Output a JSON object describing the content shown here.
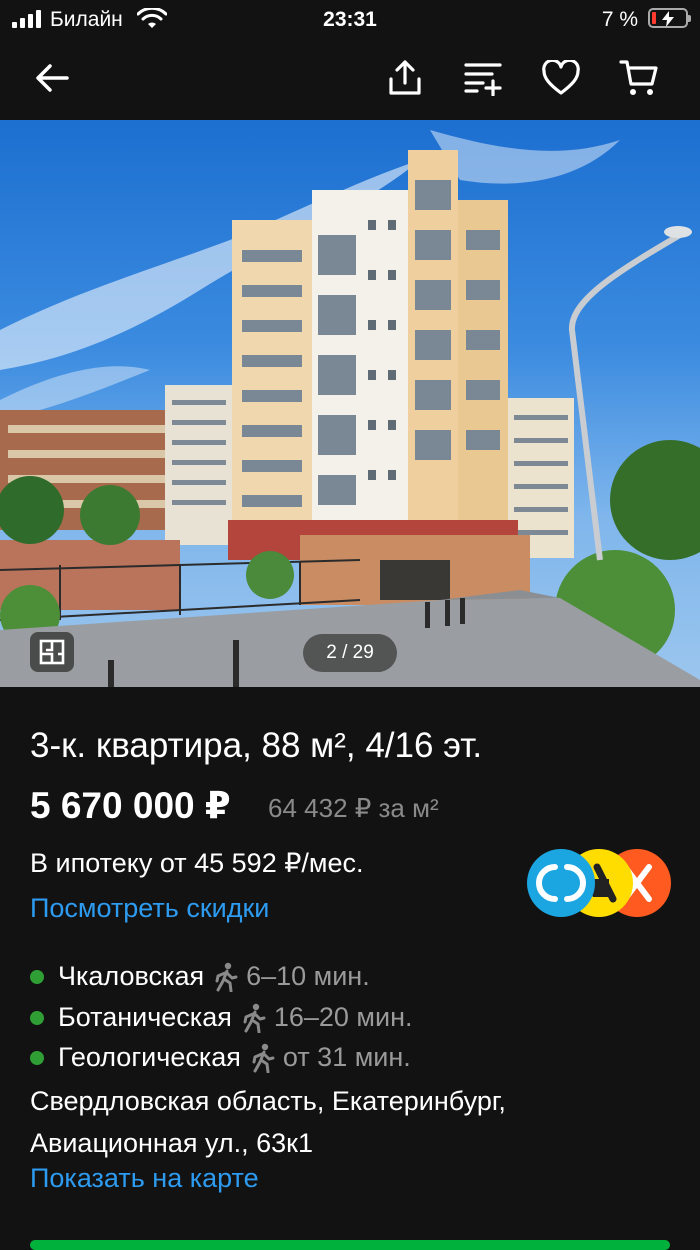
{
  "status_bar": {
    "carrier": "Билайн",
    "time": "23:31",
    "battery": "7 %"
  },
  "nav": {
    "icons": [
      "back-arrow-icon",
      "share-icon",
      "compare-icon",
      "heart-icon",
      "cart-icon"
    ]
  },
  "gallery": {
    "counter": "2 / 29"
  },
  "listing": {
    "title": "3-к. квартира, 88 м², 4/16 эт.",
    "price": "5 670 000 ₽",
    "price_per_m2": "64 432 ₽ за м²",
    "mortgage": "В ипотеку от 45 592 ₽/мес.",
    "discounts_link": "Посмотреть скидки",
    "metro": [
      {
        "name": "Чкаловская",
        "time": "6–10 мин."
      },
      {
        "name": "Ботаническая",
        "time": "16–20 мин."
      },
      {
        "name": "Геологическая",
        "time": "от 31 мин."
      }
    ],
    "address_line1": "Свердловская область, Екатеринбург,",
    "address_line2": "Авиационная ул., 63к1",
    "map_link": "Показать на карте"
  },
  "colors": {
    "background": "#121212",
    "link": "#2d9bf0",
    "metro_dot": "#2e9e35",
    "cta": "#00b23b"
  }
}
